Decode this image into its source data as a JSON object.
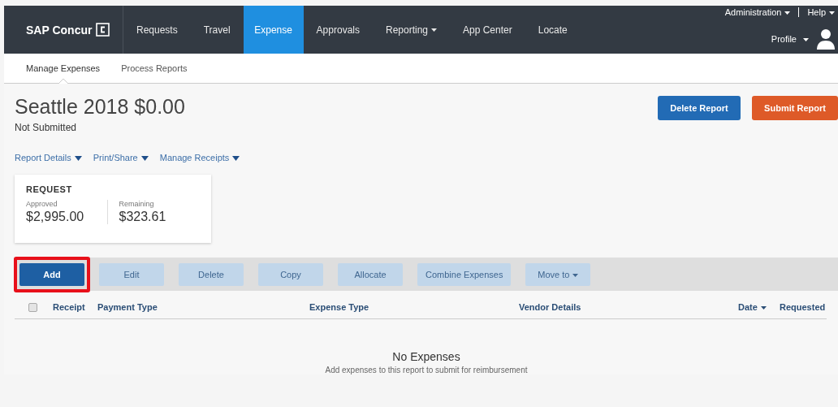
{
  "top_bar": {
    "brand": "SAP Concur",
    "nav": [
      {
        "label": "Requests",
        "selected": false,
        "caret": false
      },
      {
        "label": "Travel",
        "selected": false,
        "caret": false
      },
      {
        "label": "Expense",
        "selected": true,
        "caret": false
      },
      {
        "label": "Approvals",
        "selected": false,
        "caret": false
      },
      {
        "label": "Reporting",
        "selected": false,
        "caret": true
      },
      {
        "label": "App Center",
        "selected": false,
        "caret": false
      },
      {
        "label": "Locate",
        "selected": false,
        "caret": false
      }
    ],
    "admin": "Administration",
    "help": "Help",
    "profile": "Profile"
  },
  "sub_nav": [
    {
      "label": "Manage Expenses",
      "selected": true
    },
    {
      "label": "Process Reports",
      "selected": false
    }
  ],
  "report": {
    "title": "Seattle 2018 $0.00",
    "status": "Not Submitted"
  },
  "header_buttons": [
    {
      "label": "Delete Report",
      "kind": "secondary"
    },
    {
      "label": "Submit Report",
      "kind": "primary"
    }
  ],
  "menus": [
    "Report Details",
    "Print/Share",
    "Manage Receipts"
  ],
  "request_card": {
    "heading": "REQUEST",
    "approved_label": "Approved",
    "approved": "$2,995.00",
    "remaining_label": "Remaining",
    "remaining": "$323.61"
  },
  "toolbar": [
    {
      "label": "Add",
      "disabled": false,
      "highlighted": true,
      "caret": false
    },
    {
      "label": "Edit",
      "disabled": true,
      "highlighted": false,
      "caret": false
    },
    {
      "label": "Delete",
      "disabled": true,
      "highlighted": false,
      "caret": false
    },
    {
      "label": "Copy",
      "disabled": true,
      "highlighted": false,
      "caret": false
    },
    {
      "label": "Allocate",
      "disabled": true,
      "highlighted": false,
      "caret": false
    },
    {
      "label": "Combine Expenses",
      "disabled": true,
      "highlighted": false,
      "caret": false
    },
    {
      "label": "Move to",
      "disabled": true,
      "highlighted": false,
      "caret": true
    }
  ],
  "table": {
    "select_all_checked": false,
    "columns": [
      {
        "label": "Receipt",
        "sorted": false
      },
      {
        "label": "Payment Type",
        "sorted": false
      },
      {
        "label": "Expense Type",
        "sorted": false
      },
      {
        "label": "Vendor Details",
        "sorted": false
      },
      {
        "label": "Date",
        "sorted": true
      },
      {
        "label": "Requested",
        "sorted": false
      }
    ],
    "empty_title": "No Expenses",
    "empty_text": "Add expenses to this report to submit for reimbursement"
  }
}
